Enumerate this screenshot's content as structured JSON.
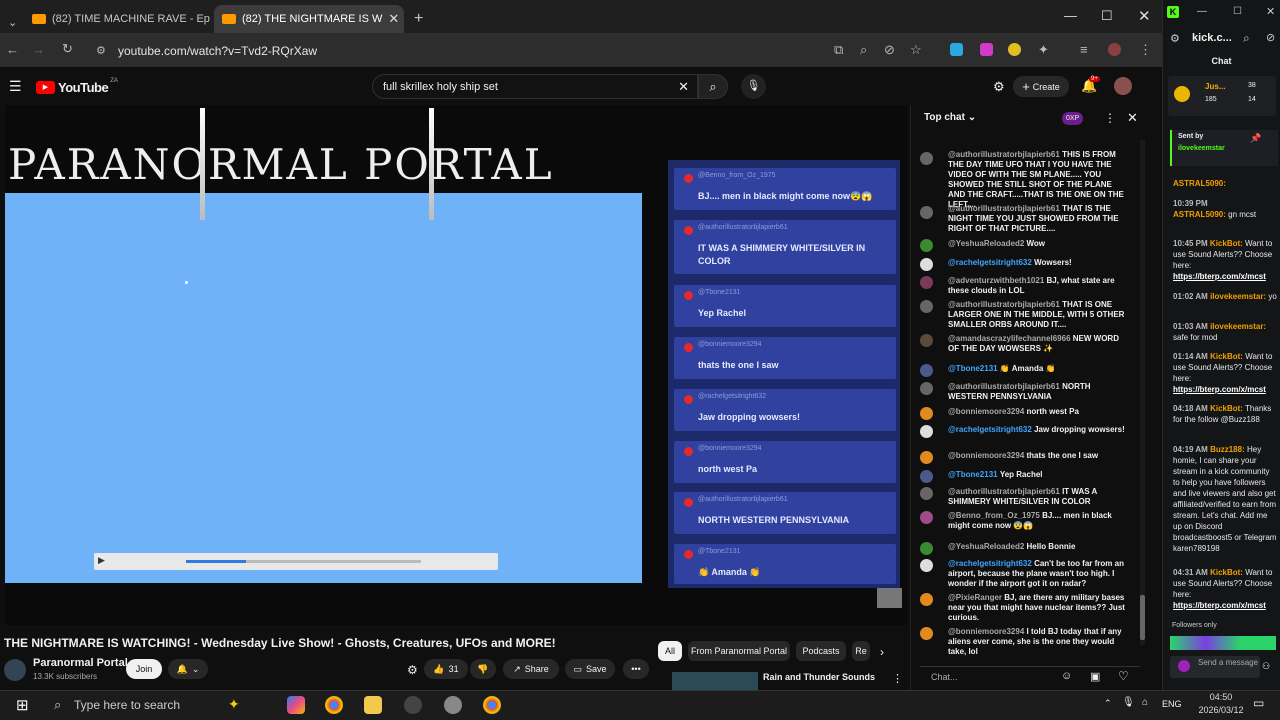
{
  "browser_tabs": [
    {
      "label": "(82) TIME MACHINE RAVE - Ep"
    },
    {
      "label": "(82) THE NIGHTMARE IS W"
    }
  ],
  "address": {
    "url": "youtube.com/watch?v=Tvd2-RQrXaw"
  },
  "youtube": {
    "logo": "YouTube",
    "region": "ZA",
    "search_value": "full skrillex holy ship set",
    "create_label": "Create",
    "notif_count": "9+"
  },
  "video": {
    "logo_text": "PARANORMAL PORTAL",
    "overlay_messages": [
      {
        "user": "@Benno_from_Oz_1975",
        "text": "BJ.... men in black might come now😨😱"
      },
      {
        "user": "@authorillustratorbjlapierb61",
        "text": "IT WAS A SHIMMERY WHITE/SILVER IN COLOR"
      },
      {
        "user": "@Tbone2131",
        "text": "Yep Rachel"
      },
      {
        "user": "@bonniemoore3294",
        "text": "thats the one I saw"
      },
      {
        "user": "@rachelgetsitright632",
        "text": "Jaw dropping wowsers!"
      },
      {
        "user": "@bonniemoore3294",
        "text": "north west Pa"
      },
      {
        "user": "@authorillustratorbjlapierb61",
        "text": "NORTH WESTERN PENNSYLVANIA"
      },
      {
        "user": "@Tbone2131",
        "text": "👏 Amanda 👏"
      }
    ],
    "title": "THE NIGHTMARE IS WATCHING! - Wednesday Live Show! - Ghosts, Creatures, UFOs and MORE!",
    "channel": "Paranormal Portal",
    "subscribers": "13.3K subscribers",
    "join_label": "Join",
    "likes": "31",
    "share_label": "Share",
    "save_label": "Save",
    "filters": [
      "All",
      "From Paranormal Portal",
      "Podcasts",
      "Re"
    ],
    "related_title": "Rain and Thunder Sounds"
  },
  "ytchat": {
    "header": "Top chat",
    "points": "0XP",
    "input_placeholder": "Chat...",
    "messages": [
      {
        "user": "@authorillustratorbjlapierb61",
        "text": "THIS IS FROM THE DAY TIME UFO THAT I YOU HAVE THE VIDEO OF WITH THE SM PLANE..... YOU SHOWED THE STILL SHOT OF THE PLANE AND THE CRAFT.....THAT IS THE ONE ON THE LEFT....",
        "blue": false
      },
      {
        "user": "@authorillustratorbjlapierb61",
        "text": "THAT IS THE NIGHT TIME YOU JUST SHOWED FROM THE RIGHT OF THAT PICTURE....",
        "blue": false
      },
      {
        "user": "@YeshuaReloaded2",
        "text": "Wow",
        "blue": false
      },
      {
        "user": "@rachelgetsitright632",
        "text": "Wowsers!",
        "blue": true
      },
      {
        "user": "@adventurzwithbeth1021",
        "text": "BJ, what state are these clouds in LOL",
        "blue": false
      },
      {
        "user": "@authorillustratorbjlapierb61",
        "text": "THAT IS ONE LARGER ONE IN THE MIDDLE, WITH 5 OTHER SMALLER ORBS AROUND IT....",
        "blue": false
      },
      {
        "user": "@amandascrazylifechannel6966",
        "text": "NEW WORD OF THE DAY WOWSERS ✨",
        "blue": false
      },
      {
        "user": "@Tbone2131",
        "text": "👏 Amanda 👏",
        "blue": true
      },
      {
        "user": "@authorillustratorbjlapierb61",
        "text": "NORTH WESTERN PENNSYLVANIA",
        "blue": false
      },
      {
        "user": "@bonniemoore3294",
        "text": "north west Pa",
        "blue": false
      },
      {
        "user": "@rachelgetsitright632",
        "text": "Jaw dropping wowsers!",
        "blue": true
      },
      {
        "user": "@bonniemoore3294",
        "text": "thats the one I saw",
        "blue": false
      },
      {
        "user": "@Tbone2131",
        "text": "Yep Rachel",
        "blue": true
      },
      {
        "user": "@authorillustratorbjlapierb61",
        "text": "IT WAS A SHIMMERY WHITE/SILVER IN COLOR",
        "blue": false
      },
      {
        "user": "@Benno_from_Oz_1975",
        "text": "BJ.... men in black might come now 😨😱",
        "blue": false
      },
      {
        "user": "@YeshuaReloaded2",
        "text": "Hello Bonnie",
        "blue": false
      },
      {
        "user": "@rachelgetsitright632",
        "text": "Can't be too far from an airport, because the plane wasn't too high. I wonder if the airport got it on radar?",
        "blue": true
      },
      {
        "user": "@PixieRanger",
        "text": "BJ, are there any military bases near you that might have nuclear items?? Just curious.",
        "blue": false
      },
      {
        "user": "@bonniemoore3294",
        "text": "I told BJ today that if any aliens ever come, she is the one they would take, lol",
        "blue": false
      }
    ]
  },
  "kick": {
    "url": "kick.c...",
    "tab": "Chat",
    "top_user": "Jus...",
    "stat1": "38",
    "stat2": "185",
    "stat3": "14",
    "sent_by": "Sent by",
    "sent_user": "ilovekeemstar",
    "messages": [
      {
        "ts": "",
        "name": "ASTRAL5090:",
        "text": ""
      },
      {
        "ts": "10:39 PM",
        "name": "ASTRAL5090:",
        "text": "gn mcst"
      },
      {
        "ts": "10:45 PM",
        "name": "KickBot:",
        "text": "Want to use Sound Alerts?? Choose here:",
        "link": "https://bterp.com/x/mcst"
      },
      {
        "ts": "01:02 AM",
        "name": "ilovekeemstar:",
        "text": "yo"
      },
      {
        "ts": "01:03 AM",
        "name": "ilovekeemstar:",
        "text": "safe for mod"
      },
      {
        "ts": "01:14 AM",
        "name": "KickBot:",
        "text": "Want to use Sound Alerts?? Choose here:",
        "link": "https://bterp.com/x/mcst"
      },
      {
        "ts": "04:18 AM",
        "name": "KickBot:",
        "text": "Thanks for the follow @Buzz188"
      },
      {
        "ts": "04:19 AM",
        "name": "Buzz188:",
        "text": "Hey homie, I can share your stream in a kick community to help you have followers and live viewers and also get affiliated/verified to earn from stream. Let's chat. Add me up on Discord broadcastboost5 or Telegram karen789198"
      },
      {
        "ts": "04:31 AM",
        "name": "KickBot:",
        "text": "Want to use Sound Alerts?? Choose here:",
        "link": "https://bterp.com/x/mcst"
      }
    ],
    "followers_only": "Followers only",
    "send_placeholder": "Send a message"
  },
  "taskbar": {
    "search_placeholder": "Type here to search",
    "lang": "ENG",
    "time": "04:50",
    "date": "2026/03/12"
  }
}
